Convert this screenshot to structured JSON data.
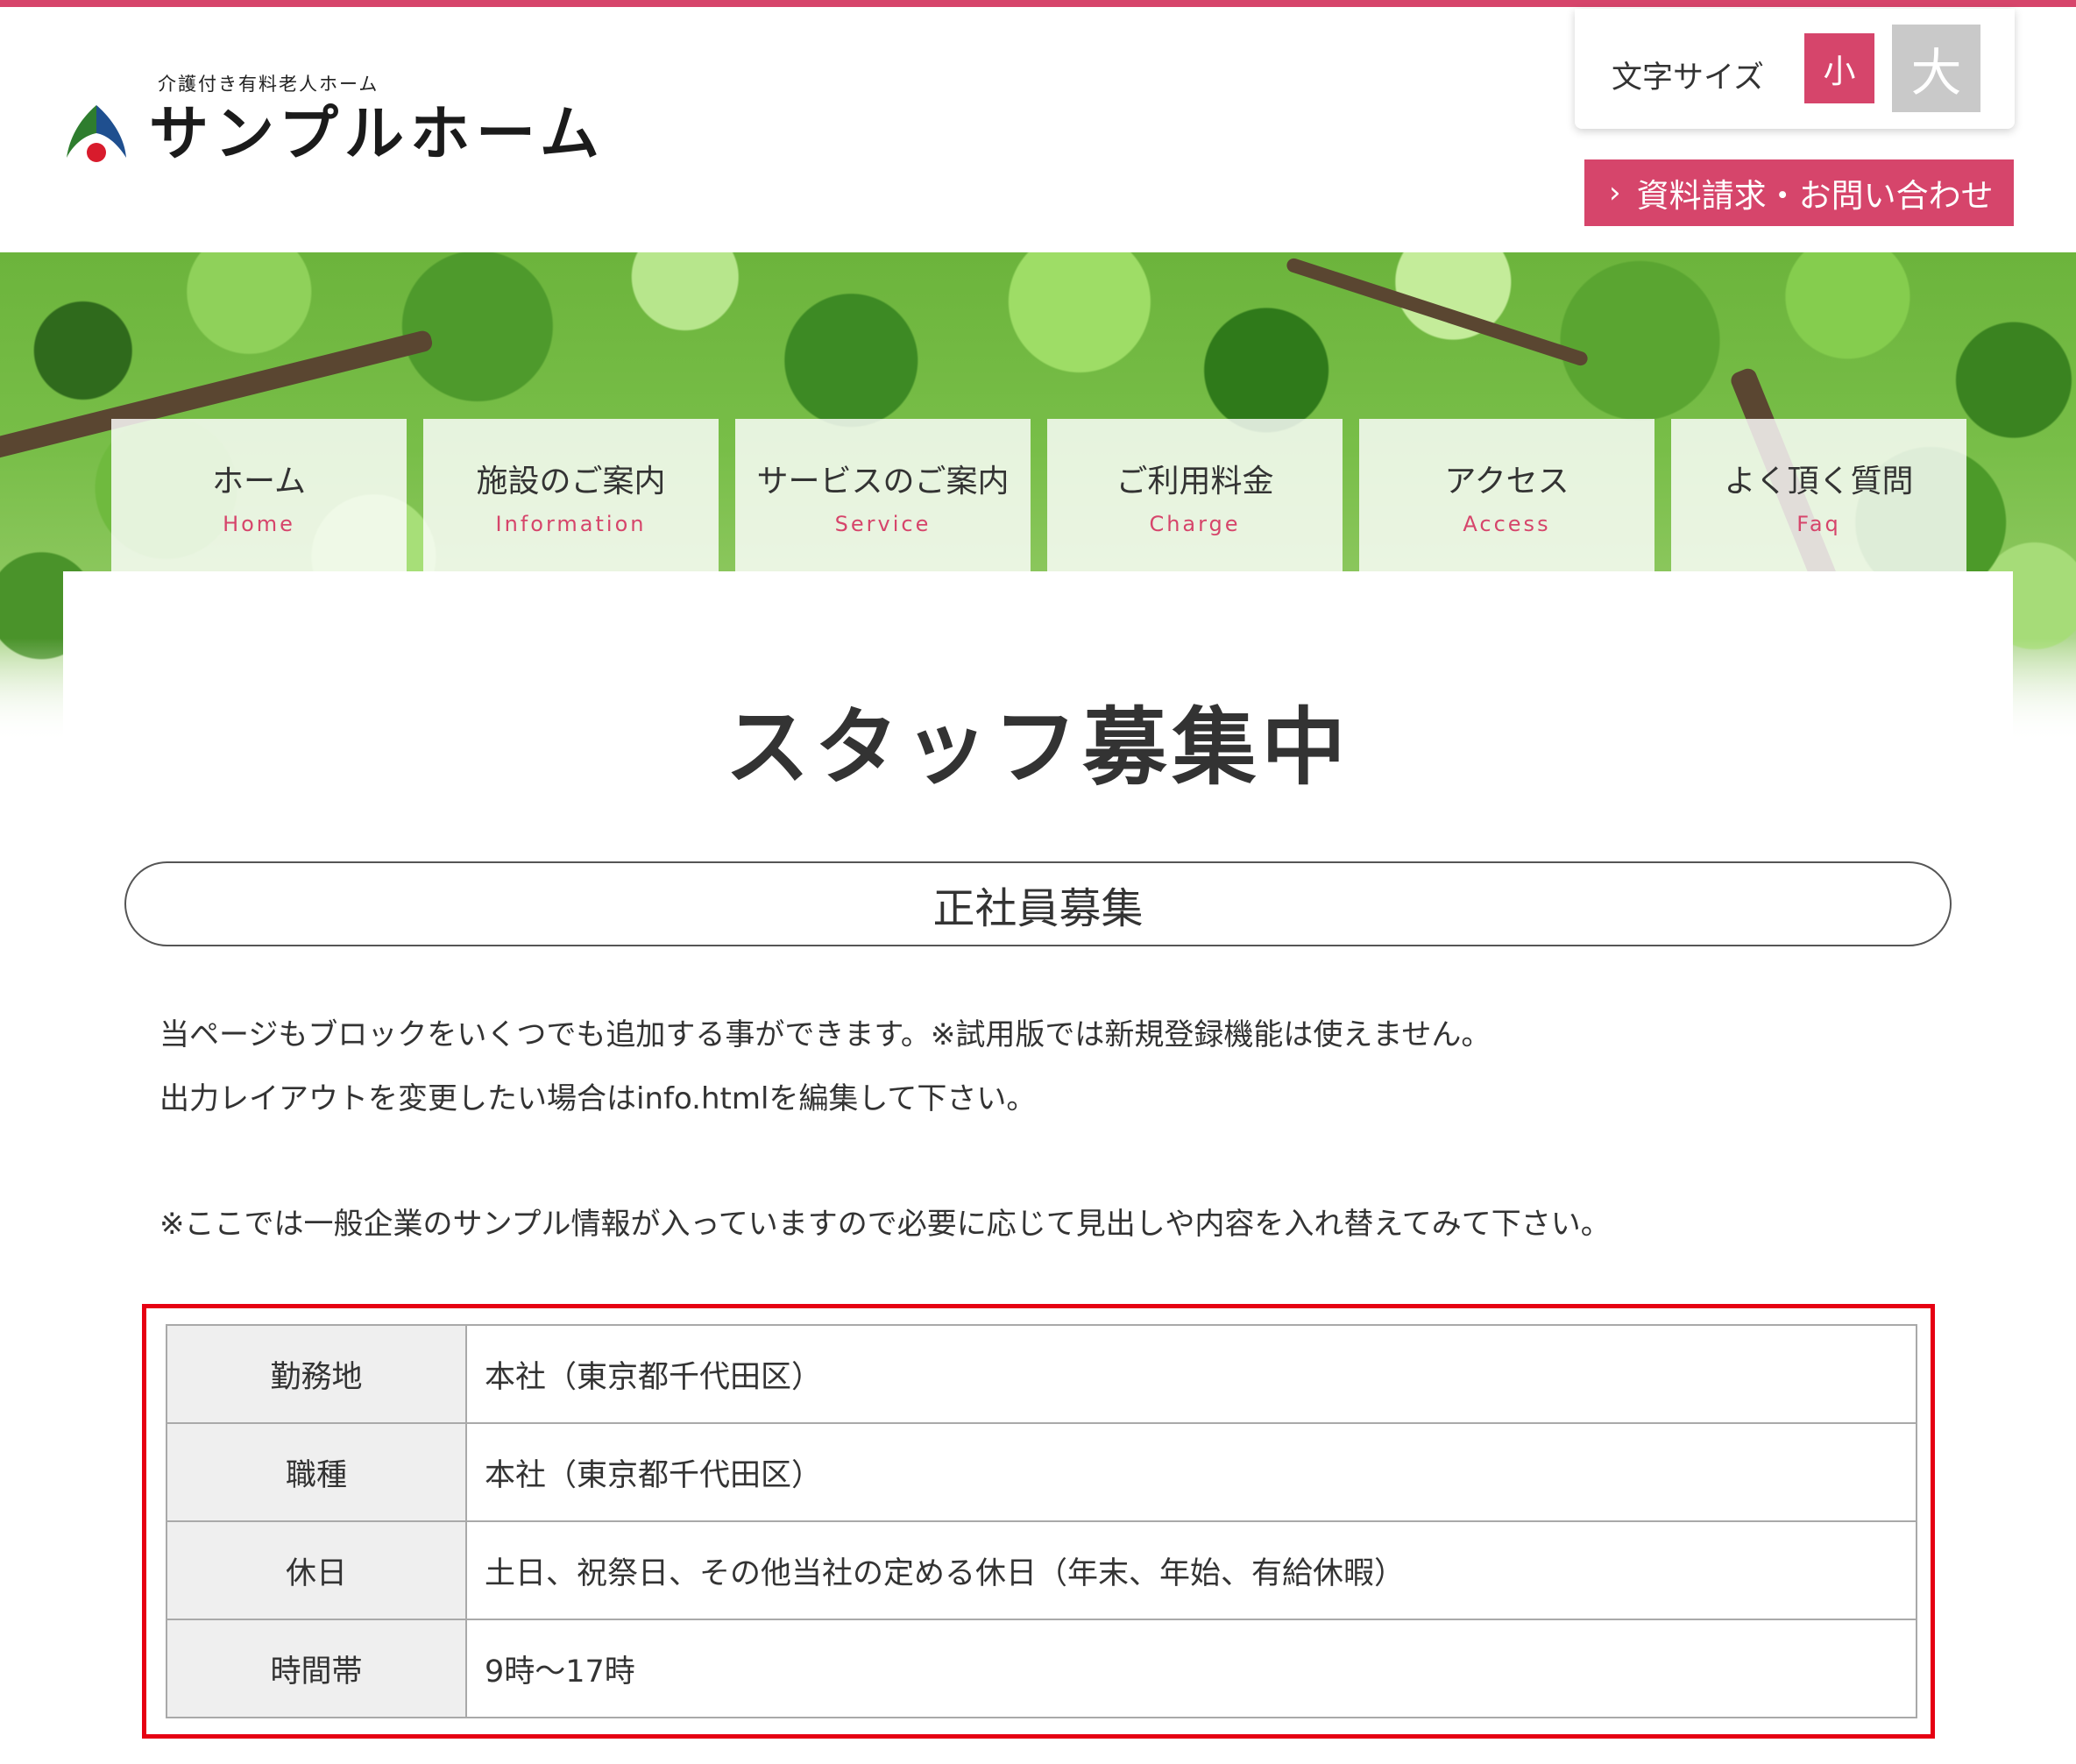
{
  "header": {
    "logo_subtitle": "介護付き有料老人ホーム",
    "logo_title": "サンプルホーム",
    "font_size": {
      "label": "文字サイズ",
      "small": "小",
      "large": "大"
    },
    "contact_button": "資料請求・お問い合わせ"
  },
  "nav": [
    {
      "jp": "ホーム",
      "en": "Home"
    },
    {
      "jp": "施設のご案内",
      "en": "Information"
    },
    {
      "jp": "サービスのご案内",
      "en": "Service"
    },
    {
      "jp": "ご利用料金",
      "en": "Charge"
    },
    {
      "jp": "アクセス",
      "en": "Access"
    },
    {
      "jp": "よく頂く質問",
      "en": "Faq"
    }
  ],
  "main": {
    "page_title": "スタッフ募集中",
    "section_heading": "正社員募集",
    "paragraphs": [
      "当ページもブロックをいくつでも追加する事ができます。※試用版では新規登録機能は使えません。",
      "出力レイアウトを変更したい場合はinfo.htmlを編集して下さい。",
      "※ここでは一般企業のサンプル情報が入っていますので必要に応じて見出しや内容を入れ替えてみて下さい。"
    ],
    "table": [
      {
        "label": "勤務地",
        "value": "本社（東京都千代田区）"
      },
      {
        "label": "職種",
        "value": "本社（東京都千代田区）"
      },
      {
        "label": "休日",
        "value": "土日、祝祭日、その他当社の定める休日（年末、年始、有給休暇）"
      },
      {
        "label": "時間帯",
        "value": "9時〜17時"
      }
    ]
  },
  "colors": {
    "accent": "#d6456b",
    "highlight_border": "#e60012",
    "font_large_button": "#c9c9c9"
  },
  "icons": {
    "logo": "leaf-logo-icon",
    "contact_chevron": "chevron-right-icon"
  }
}
